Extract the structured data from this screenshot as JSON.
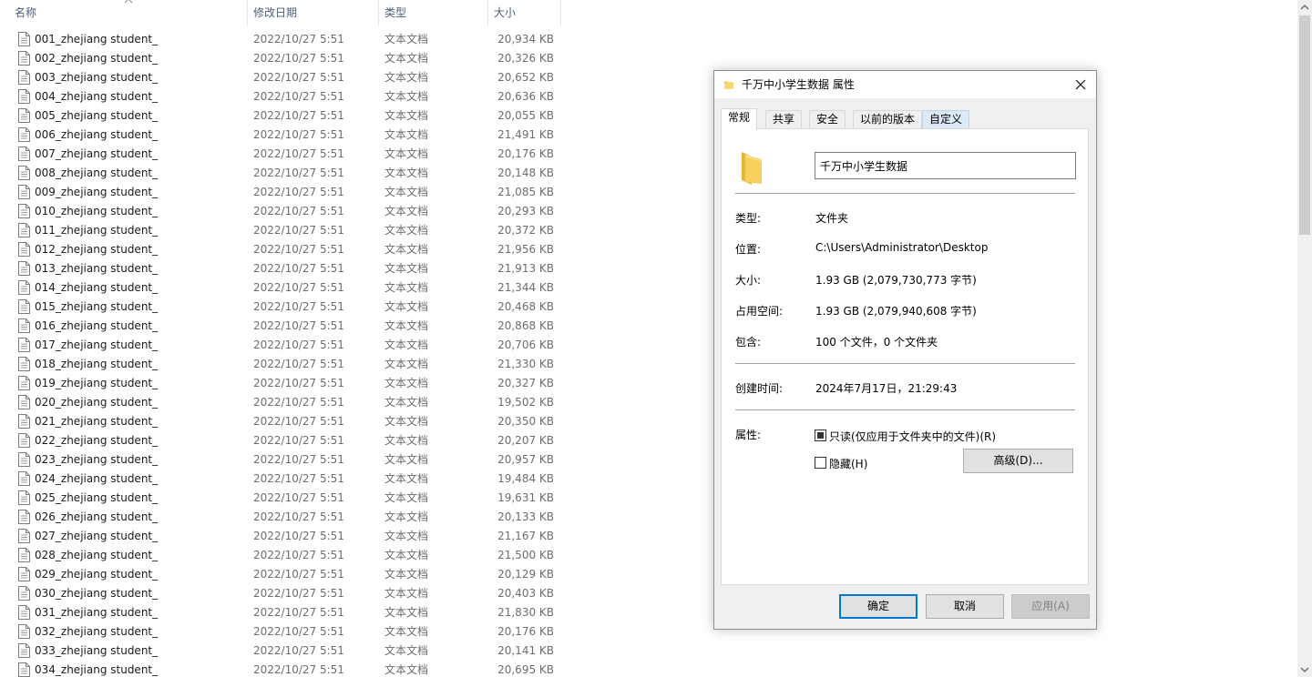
{
  "explorer": {
    "columns": {
      "name": "名称",
      "date": "修改日期",
      "type": "类型",
      "size": "大小"
    },
    "files": [
      {
        "name": "001_zhejiang student_",
        "date": "2022/10/27 5:51",
        "type": "文本文档",
        "size": "20,934 KB"
      },
      {
        "name": "002_zhejiang student_",
        "date": "2022/10/27 5:51",
        "type": "文本文档",
        "size": "20,326 KB"
      },
      {
        "name": "003_zhejiang student_",
        "date": "2022/10/27 5:51",
        "type": "文本文档",
        "size": "20,652 KB"
      },
      {
        "name": "004_zhejiang student_",
        "date": "2022/10/27 5:51",
        "type": "文本文档",
        "size": "20,636 KB"
      },
      {
        "name": "005_zhejiang student_",
        "date": "2022/10/27 5:51",
        "type": "文本文档",
        "size": "20,055 KB"
      },
      {
        "name": "006_zhejiang student_",
        "date": "2022/10/27 5:51",
        "type": "文本文档",
        "size": "21,491 KB"
      },
      {
        "name": "007_zhejiang student_",
        "date": "2022/10/27 5:51",
        "type": "文本文档",
        "size": "20,176 KB"
      },
      {
        "name": "008_zhejiang student_",
        "date": "2022/10/27 5:51",
        "type": "文本文档",
        "size": "20,148 KB"
      },
      {
        "name": "009_zhejiang student_",
        "date": "2022/10/27 5:51",
        "type": "文本文档",
        "size": "21,085 KB"
      },
      {
        "name": "010_zhejiang student_",
        "date": "2022/10/27 5:51",
        "type": "文本文档",
        "size": "20,293 KB"
      },
      {
        "name": "011_zhejiang student_",
        "date": "2022/10/27 5:51",
        "type": "文本文档",
        "size": "20,372 KB"
      },
      {
        "name": "012_zhejiang student_",
        "date": "2022/10/27 5:51",
        "type": "文本文档",
        "size": "21,956 KB"
      },
      {
        "name": "013_zhejiang student_",
        "date": "2022/10/27 5:51",
        "type": "文本文档",
        "size": "21,913 KB"
      },
      {
        "name": "014_zhejiang student_",
        "date": "2022/10/27 5:51",
        "type": "文本文档",
        "size": "21,344 KB"
      },
      {
        "name": "015_zhejiang student_",
        "date": "2022/10/27 5:51",
        "type": "文本文档",
        "size": "20,468 KB"
      },
      {
        "name": "016_zhejiang student_",
        "date": "2022/10/27 5:51",
        "type": "文本文档",
        "size": "20,868 KB"
      },
      {
        "name": "017_zhejiang student_",
        "date": "2022/10/27 5:51",
        "type": "文本文档",
        "size": "20,706 KB"
      },
      {
        "name": "018_zhejiang student_",
        "date": "2022/10/27 5:51",
        "type": "文本文档",
        "size": "21,330 KB"
      },
      {
        "name": "019_zhejiang student_",
        "date": "2022/10/27 5:51",
        "type": "文本文档",
        "size": "20,327 KB"
      },
      {
        "name": "020_zhejiang student_",
        "date": "2022/10/27 5:51",
        "type": "文本文档",
        "size": "19,502 KB"
      },
      {
        "name": "021_zhejiang student_",
        "date": "2022/10/27 5:51",
        "type": "文本文档",
        "size": "20,350 KB"
      },
      {
        "name": "022_zhejiang student_",
        "date": "2022/10/27 5:51",
        "type": "文本文档",
        "size": "20,207 KB"
      },
      {
        "name": "023_zhejiang student_",
        "date": "2022/10/27 5:51",
        "type": "文本文档",
        "size": "20,957 KB"
      },
      {
        "name": "024_zhejiang student_",
        "date": "2022/10/27 5:51",
        "type": "文本文档",
        "size": "19,484 KB"
      },
      {
        "name": "025_zhejiang student_",
        "date": "2022/10/27 5:51",
        "type": "文本文档",
        "size": "19,631 KB"
      },
      {
        "name": "026_zhejiang student_",
        "date": "2022/10/27 5:51",
        "type": "文本文档",
        "size": "20,133 KB"
      },
      {
        "name": "027_zhejiang student_",
        "date": "2022/10/27 5:51",
        "type": "文本文档",
        "size": "21,167 KB"
      },
      {
        "name": "028_zhejiang student_",
        "date": "2022/10/27 5:51",
        "type": "文本文档",
        "size": "21,500 KB"
      },
      {
        "name": "029_zhejiang student_",
        "date": "2022/10/27 5:51",
        "type": "文本文档",
        "size": "20,129 KB"
      },
      {
        "name": "030_zhejiang student_",
        "date": "2022/10/27 5:51",
        "type": "文本文档",
        "size": "20,403 KB"
      },
      {
        "name": "031_zhejiang student_",
        "date": "2022/10/27 5:51",
        "type": "文本文档",
        "size": "21,830 KB"
      },
      {
        "name": "032_zhejiang student_",
        "date": "2022/10/27 5:51",
        "type": "文本文档",
        "size": "20,176 KB"
      },
      {
        "name": "033_zhejiang student_",
        "date": "2022/10/27 5:51",
        "type": "文本文档",
        "size": "20,141 KB"
      },
      {
        "name": "034_zhejiang student_",
        "date": "2022/10/27 5:51",
        "type": "文本文档",
        "size": "20,695 KB"
      }
    ],
    "icons": {
      "file": "text-file-icon",
      "sort": "sort-ascending-icon"
    }
  },
  "dialog": {
    "title": "千万中小学生数据 属性",
    "tabs": [
      "常规",
      "共享",
      "安全",
      "以前的版本",
      "自定义"
    ],
    "active_tab": "常规",
    "folder_name": "千万中小学生数据",
    "properties": {
      "type_label": "类型:",
      "type_value": "文件夹",
      "location_label": "位置:",
      "location_value": "C:\\Users\\Administrator\\Desktop",
      "size_label": "大小:",
      "size_value": "1.93 GB (2,079,730,773 字节)",
      "disk_label": "占用空间:",
      "disk_value": "1.93 GB (2,079,940,608 字节)",
      "contains_label": "包含:",
      "contains_value": "100 个文件，0 个文件夹",
      "created_label": "创建时间:",
      "created_value": "2024年7月17日，21:29:43",
      "attributes_label": "属性:"
    },
    "attributes": {
      "readonly_label": "只读(仅应用于文件夹中的文件)(R)",
      "readonly_state": "indeterminate",
      "hidden_label": "隐藏(H)",
      "hidden_checked": false,
      "advanced_button": "高级(D)..."
    },
    "buttons": {
      "ok": "确定",
      "cancel": "取消",
      "apply": "应用(A)"
    },
    "colors": {
      "accent": "#0078d7",
      "folder": "#f4c84a"
    }
  }
}
